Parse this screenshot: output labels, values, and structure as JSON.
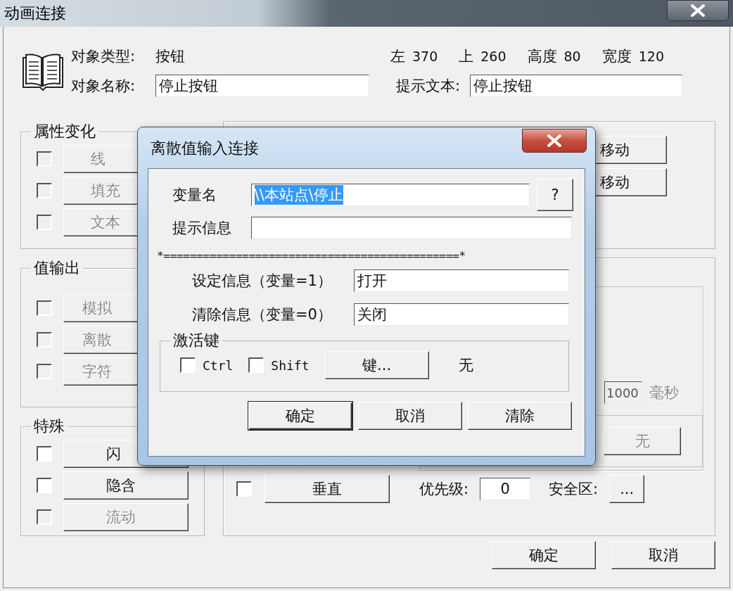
{
  "window": {
    "title": "动画连接"
  },
  "object": {
    "type_label": "对象类型:",
    "type_value": "按钮",
    "name_label": "对象名称:",
    "name_value": "停止按钮",
    "tooltip_label": "提示文本:",
    "tooltip_value": "停止按钮",
    "geometry": [
      {
        "label": "左",
        "value": "370"
      },
      {
        "label": "上",
        "value": "260"
      },
      {
        "label": "高度",
        "value": "80"
      },
      {
        "label": "宽度",
        "value": "120"
      }
    ]
  },
  "property_change": {
    "legend": "属性变化",
    "items": [
      {
        "label": "线",
        "checked": false,
        "disabled": true
      },
      {
        "label": "填充",
        "checked": false,
        "disabled": true
      },
      {
        "label": "文本",
        "checked": false,
        "disabled": true
      }
    ]
  },
  "value_output": {
    "legend": "值输出",
    "items": [
      {
        "label": "模拟",
        "checked": false,
        "disabled": true
      },
      {
        "label": "离散",
        "checked": false,
        "disabled": true
      },
      {
        "label": "字符",
        "checked": false,
        "disabled": true
      }
    ]
  },
  "special": {
    "legend": "特殊",
    "items": [
      {
        "label": "闪",
        "checked": false,
        "disabled": false
      },
      {
        "label": "隐含",
        "checked": false,
        "disabled": false
      },
      {
        "label": "流动",
        "checked": false,
        "disabled": true
      }
    ]
  },
  "move_buttons": [
    {
      "label": "移动"
    },
    {
      "label": "移动"
    }
  ],
  "blink": {
    "value": "1000",
    "unit": "毫秒",
    "disabled": true,
    "button": {
      "label": "无",
      "disabled": true
    }
  },
  "vertical": {
    "label": "垂直",
    "checked": false
  },
  "priority": {
    "label": "优先级:",
    "value": "0"
  },
  "safety": {
    "label": "安全区:",
    "button": "..."
  },
  "footer_buttons": [
    {
      "label": "确定"
    },
    {
      "label": "取消"
    }
  ],
  "modal": {
    "title": "离散值输入连接",
    "variable": {
      "label": "变量名",
      "value": "\\\\本站点\\停止",
      "selected": true
    },
    "help_button": "?",
    "hint": {
      "label": "提示信息"
    },
    "separator": "*=============================================*",
    "set": {
      "label": "设定信息（变量=1）",
      "value": "打开"
    },
    "clear": {
      "label": "清除信息（变量=0）",
      "value": "关闭"
    },
    "hotkey": {
      "legend": "激活键",
      "modifiers": [
        {
          "label": "Ctrl",
          "checked": false
        },
        {
          "label": "Shift",
          "checked": false
        }
      ],
      "key_button": "键...",
      "key_value": "无"
    },
    "buttons": [
      {
        "label": "确定",
        "default": true
      },
      {
        "label": "取消",
        "default": false
      },
      {
        "label": "清除",
        "default": false
      }
    ]
  }
}
